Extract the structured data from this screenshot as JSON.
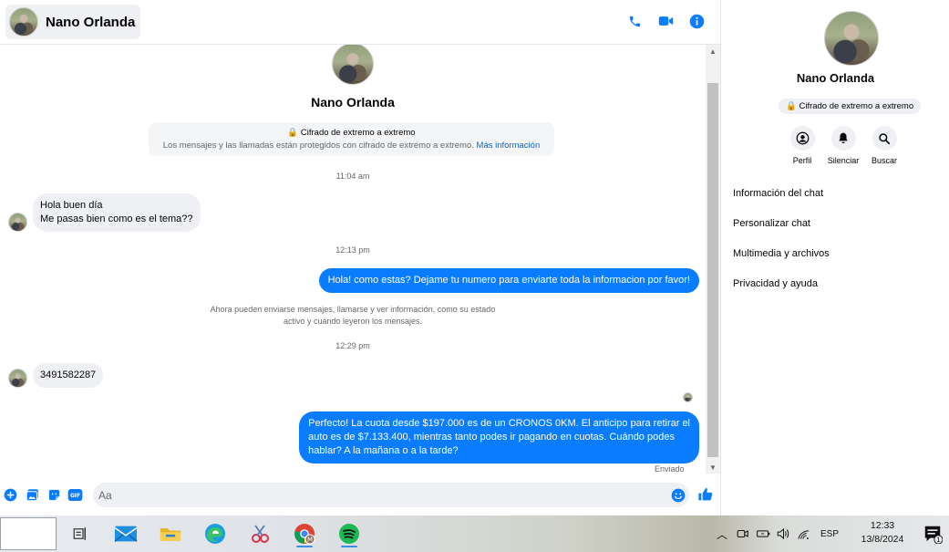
{
  "header": {
    "contact_name": "Nano Orlanda"
  },
  "profile": {
    "name": "Nano Orlanda"
  },
  "encryption": {
    "title": "🔒 Cifrado de extremo a extremo",
    "subtitle": "Los mensajes y las llamadas están protegidos con cifrado de extremo a extremo.",
    "link": "Más información"
  },
  "messages": {
    "time1": "11:04 am",
    "in1_line1": "Hola buen día",
    "in1_line2": "Me pasas bien como es el tema??",
    "time2": "12:13 pm",
    "out1": "Hola! como estas? Dejame tu numero para enviarte toda la informacion por favor!",
    "notice_line1": "Ahora pueden enviarse mensajes, llamarse y ver información, como su estado",
    "notice_line2": "activo y cuándo leyeron los mensajes.",
    "time3": "12:29 pm",
    "in2": "3491582287",
    "out2_line1": "Perfecto! La cuota desde $197.000 es de un CRONOS 0KM. El anticipo para retirar el",
    "out2_line2": "auto es de $7.133.400, mientras tanto podes ir pagando en cuotas. Cuándo podes",
    "out2_line3": "hablar? A la mañana o a la tarde?",
    "status": "Enviado"
  },
  "composer": {
    "placeholder": "Aa"
  },
  "info": {
    "name": "Nano Orlanda",
    "badge": "🔒 Cifrado de extremo a extremo",
    "actions": [
      {
        "label": "Perfil"
      },
      {
        "label": "Silenciar"
      },
      {
        "label": "Buscar"
      }
    ],
    "menu": [
      "Información del chat",
      "Personalizar chat",
      "Multimedia y archivos",
      "Privacidad y ayuda"
    ]
  },
  "taskbar": {
    "language": "ESP",
    "time": "12:33",
    "date": "13/8/2024",
    "notification_count": "1",
    "chrome_badge": "M"
  },
  "colors": {
    "accent": "#0a7cff",
    "link": "#0a63d6",
    "bubble_in": "#eef0f3"
  }
}
